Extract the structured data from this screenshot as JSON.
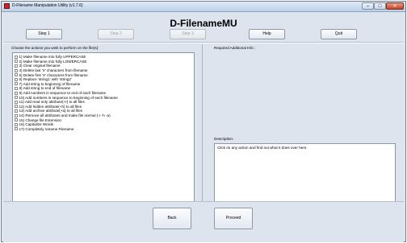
{
  "window": {
    "title": "D-Filename Manipulation Utility (v1.7.6)",
    "min_label": "–",
    "max_label": "□",
    "close_label": "✕"
  },
  "header": {
    "app_title": "D-FilenameMU"
  },
  "toolbar": {
    "step1": "Step 1",
    "step2": "Step 2",
    "step3": "Step 3",
    "help": "Help",
    "quit": "Quit"
  },
  "actions": {
    "prompt": "Choose the actions you wish to perform on the file(s):",
    "items": [
      "1) Make filename into fully UPPERCASE",
      "2) Make filename into fully LOWERCASE",
      "3) Clear original filename",
      "4) Delete last 'X' characters from filename",
      "5) Delete first 'X' characters from filename",
      "6) Replace 'string1' with 'string2'",
      "7) Add string to beginning of filename",
      "8) Add string to end of filename",
      "9) Add numbers in sequence to end of each filename",
      "10) Add numbers in sequence to beginning of each filename",
      "11) Add read only attribute(+r) to all files",
      "12) Add hidden attribute(+h) to all files",
      "13) Add archive attribute(+a) to all files",
      "14) Remove all attributes and make file normal (-r -h -a)",
      "15) Change file Extension",
      "16) Capitalize Words",
      "17) Completely rename Filename"
    ]
  },
  "info": {
    "required_label": "Required Additional Info :",
    "description_label": "Description:",
    "description_text": "Click on any action and find out what it does over here."
  },
  "nav": {
    "back": "Back",
    "proceed": "Proceed"
  }
}
